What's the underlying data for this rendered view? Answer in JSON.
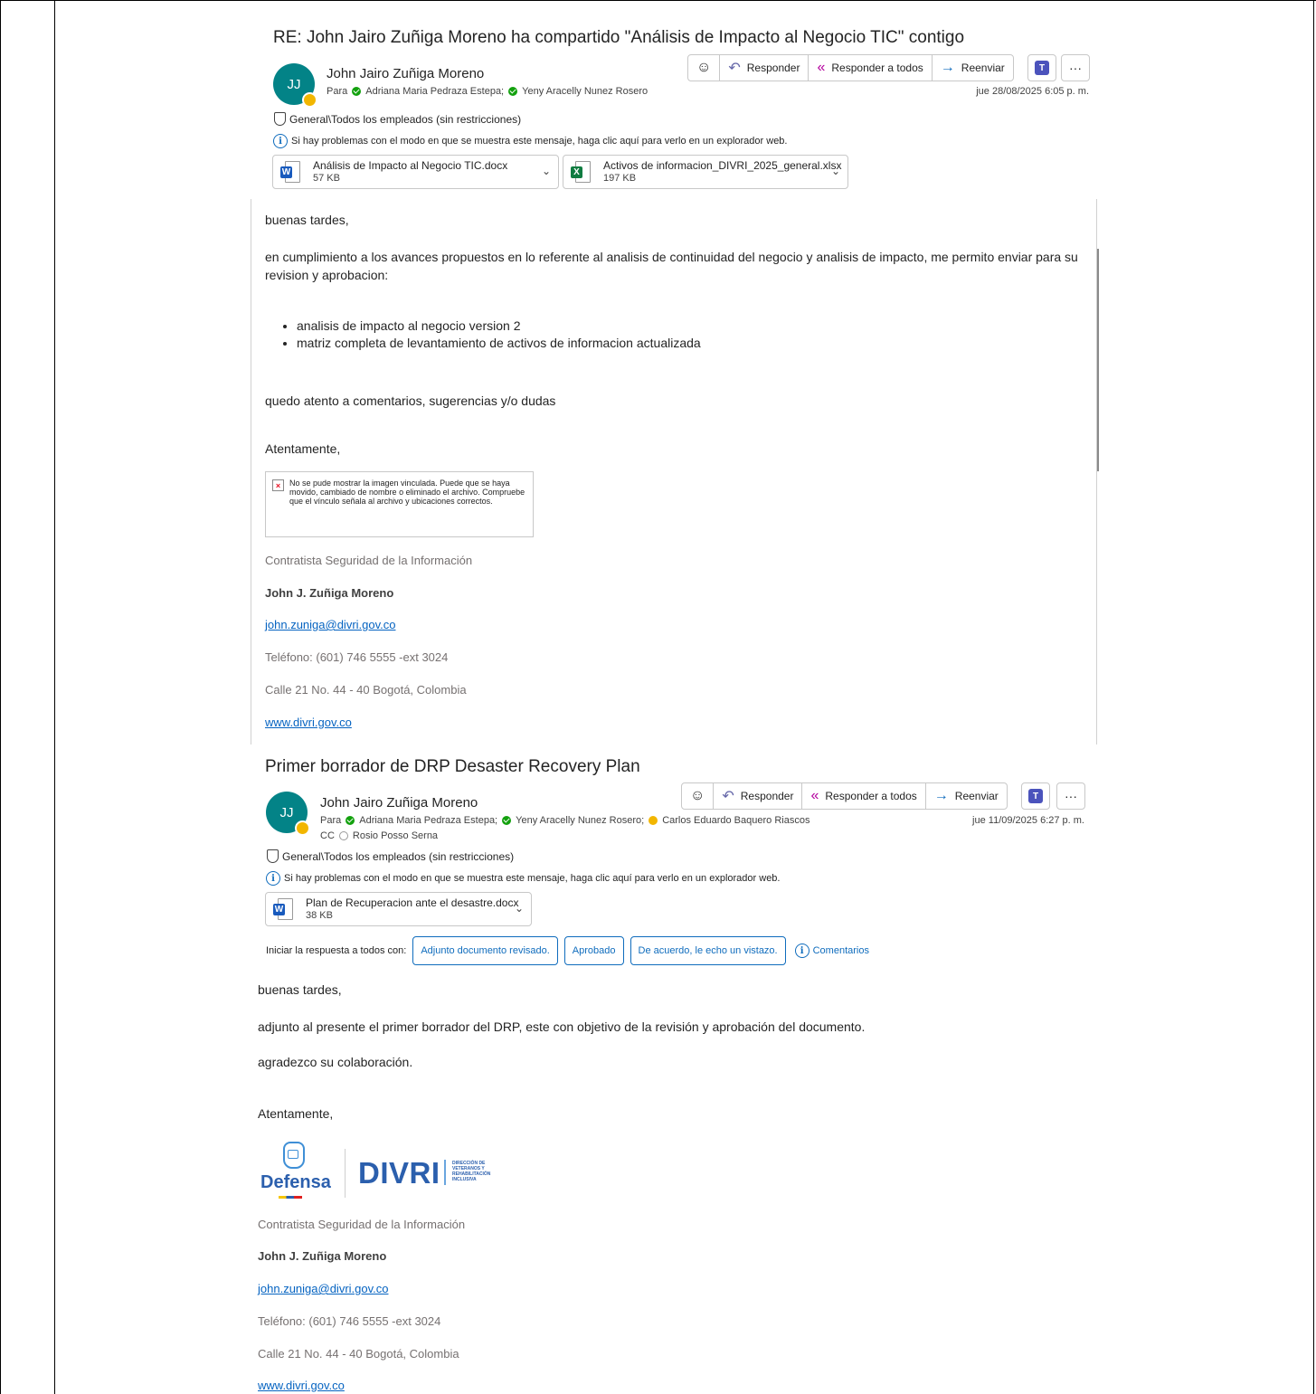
{
  "email1": {
    "subject": "RE: John Jairo Zuñiga Moreno ha compartido \"Análisis de Impacto al Negocio TIC\" contigo",
    "avatar_initials": "JJ",
    "sender": "John Jairo Zuñiga Moreno",
    "to_label": "Para",
    "recipients": [
      "Adriana Maria Pedraza Estepa;",
      "Yeny Aracelly Nunez Rosero"
    ],
    "date": "jue 28/08/2025 6:05 p. m.",
    "toolbar": {
      "reply": "Responder",
      "reply_all": "Responder a todos",
      "forward": "Reenviar",
      "more": "···"
    },
    "sensitivity": "General\\Todos los empleados (sin restricciones)",
    "info_bar": "Si hay problemas con el modo en que se muestra este mensaje, haga clic aquí para verlo en un explorador web.",
    "attachments": [
      {
        "name": "Análisis de Impacto al Negocio TIC.docx",
        "size": "57 KB",
        "type": "word"
      },
      {
        "name": "Activos de informacion_DIVRI_2025_general.xlsx",
        "size": "197 KB",
        "type": "excel"
      }
    ],
    "body": {
      "greeting": "buenas tardes,",
      "paragraph": "en cumplimiento a los avances propuestos en lo referente al analisis de continuidad del negocio y analisis de impacto, me permito enviar para su revision y aprobacion:",
      "bullets": [
        "analisis de impacto al negocio version 2",
        "matriz completa de levantamiento de activos de informacion actualizada"
      ],
      "closing_note": "quedo atento a comentarios, sugerencias y/o dudas",
      "sign_off": "Atentamente,"
    },
    "broken_image_text": "No se pude mostrar la imagen vinculada. Puede que se haya movido, cambiado de nombre o eliminado el archivo. Compruebe que el vínculo señala al archivo y ubicaciones correctos.",
    "signature": {
      "role": "Contratista Seguridad de la Información",
      "name": "John J. Zuñiga Moreno",
      "email": "john.zuniga@divri.gov.co",
      "phone": "Teléfono: (601) 746 5555 -ext 3024",
      "address": "Calle 21 No. 44 - 40 Bogotá, Colombia",
      "web": "www.divri.gov.co"
    }
  },
  "email2": {
    "subject": "Primer borrador de DRP Desaster Recovery Plan",
    "avatar_initials": "JJ",
    "sender": "John Jairo Zuñiga Moreno",
    "to_label": "Para",
    "recipients": [
      "Adriana Maria Pedraza Estepa;",
      "Yeny Aracelly Nunez Rosero;",
      "Carlos Eduardo Baquero Riascos"
    ],
    "cc_label": "CC",
    "cc": "Rosio Posso Serna",
    "date": "jue 11/09/2025 6:27 p. m.",
    "toolbar": {
      "reply": "Responder",
      "reply_all": "Responder a todos",
      "forward": "Reenviar",
      "more": "···"
    },
    "sensitivity": "General\\Todos los empleados (sin restricciones)",
    "info_bar": "Si hay problemas con el modo en que se muestra este mensaje, haga clic aquí para verlo en un explorador web.",
    "attachments": [
      {
        "name": "Plan de Recuperacion ante el desastre.docx",
        "size": "38 KB",
        "type": "word"
      }
    ],
    "quick_reply": {
      "label": "Iniciar la respuesta a todos con:",
      "options": [
        "Adjunto documento revisado.",
        "Aprobado",
        "De acuerdo, le echo un vistazo."
      ],
      "comments": "Comentarios"
    },
    "body": {
      "greeting": "buenas tardes,",
      "paragraph": "adjunto al presente el primer borrador del DRP, este con objetivo de la revisión y aprobación del documento.",
      "thanks": "agradezco su colaboración.",
      "sign_off": "Atentamente,"
    },
    "logo": {
      "defensa": "Defensa",
      "divri": "DIVRI",
      "divri_subtitle": "DIRECCIÓN DE VETERANOS Y REHABILITACIÓN INCLUSIVA"
    },
    "signature": {
      "role": "Contratista Seguridad de la Información",
      "name": "John J. Zuñiga Moreno",
      "email": "john.zuniga@divri.gov.co",
      "phone": "Teléfono: (601) 746 5555 -ext 3024",
      "address": "Calle 21 No. 44 - 40 Bogotá, Colombia",
      "web": "www.divri.gov.co"
    }
  }
}
